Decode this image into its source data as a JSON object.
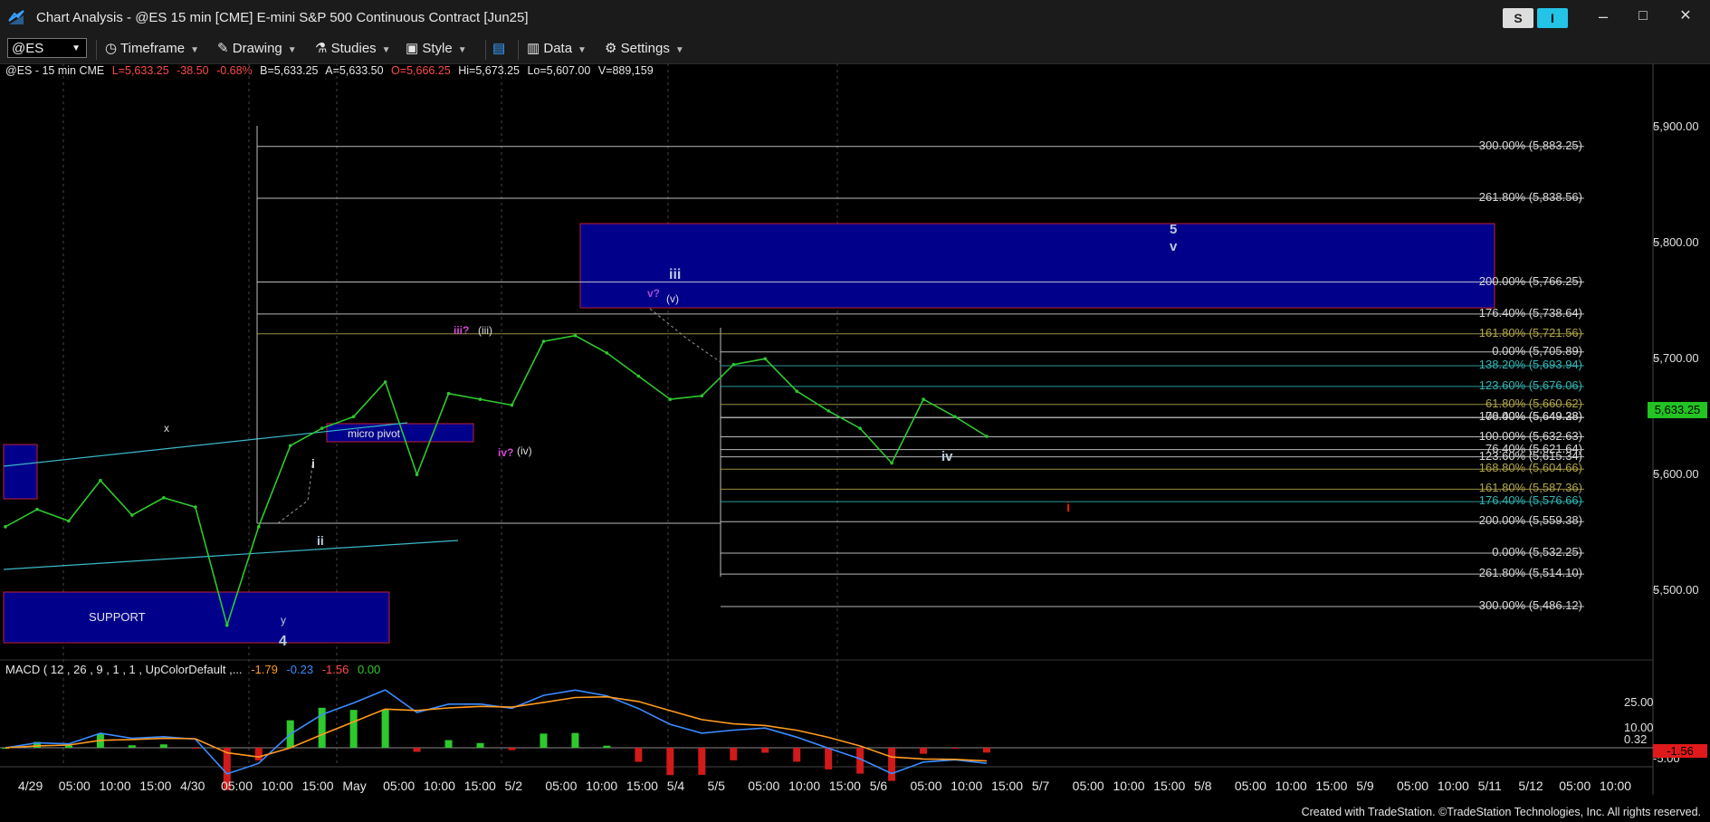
{
  "window": {
    "title": "Chart Analysis - @ES 15 min [CME] E-mini S&P 500 Continuous Contract [Jun25]",
    "s_button": "S",
    "i_button": "I",
    "minimize": "–",
    "maximize": "□",
    "close": "✕"
  },
  "toolbar": {
    "symbol": "@ES",
    "timeframe": "Timeframe",
    "drawing": "Drawing",
    "studies": "Studies",
    "style": "Style",
    "data": "Data",
    "settings": "Settings"
  },
  "quote": {
    "symbol_info": "@ES - 15 min  CME",
    "last": "L=5,633.25",
    "change": "-38.50",
    "pct": "-0.68%",
    "bid": "B=5,633.25",
    "ask": "A=5,633.50",
    "open": "O=5,666.25",
    "high": "Hi=5,673.25",
    "low": "Lo=5,607.00",
    "volume": "V=889,159"
  },
  "price_axis": {
    "labels": [
      "5,900.00",
      "5,800.00",
      "5,700.00",
      "5,600.00",
      "5,500.00"
    ],
    "last_price": "5,633.25"
  },
  "macd": {
    "title": "MACD ( 12 , 26 , 9 , 1 , 1 , UpColorDefault ,...",
    "v1": "-1.79",
    "v2": "-0.23",
    "v3": "-1.56",
    "v4": "0.00",
    "axis": [
      "25.00",
      "10.00",
      "-5.00"
    ],
    "zero_label": "0.32",
    "last_label": "-1.56"
  },
  "date_axis": [
    "4/29",
    "05:00",
    "10:00",
    "15:00",
    "4/30",
    "05:00",
    "10:00",
    "15:00",
    "May",
    "05:00",
    "10:00",
    "15:00",
    "5/2",
    "05:00",
    "10:00",
    "15:00",
    "5/4",
    "5/5",
    "05:00",
    "10:00",
    "15:00",
    "5/6",
    "05:00",
    "10:00",
    "15:00",
    "5/7",
    "05:00",
    "10:00",
    "15:00",
    "5/8",
    "05:00",
    "10:00",
    "15:00",
    "5/9",
    "05:00",
    "10:00",
    "5/11",
    "5/12",
    "05:00",
    "10:00"
  ],
  "annotations": {
    "wave_4": "4",
    "wave_y": "y",
    "wave_x": "x",
    "wave_i": "i",
    "wave_ii": "ii",
    "wave_iii_q": "iii?",
    "wave_iii_paren": "(iii)",
    "wave_iv_q": "iv?",
    "wave_iv_paren": "(iv)",
    "wave_iii": "iii",
    "wave_v_q": "v?",
    "wave_v_paren": "(v)",
    "wave_iv": "iv",
    "wave_5": "5",
    "wave_v": "v",
    "wave_i_red": "i",
    "support": "SUPPORT",
    "micro_pivot": "micro pivot"
  },
  "fib_levels_upper": [
    {
      "label": "300.00% (5,883.25)",
      "price": 5883.25
    },
    {
      "label": "261.80% (5,838.56)",
      "price": 5838.56
    },
    {
      "label": "200.00% (5,766.25)",
      "price": 5766.25
    },
    {
      "label": "176.40% (5,738.64)",
      "price": 5738.64
    },
    {
      "label": "161.80% (5,721.56)",
      "price": 5721.56
    }
  ],
  "fib_levels_lower": [
    {
      "label": "0.00% (5,705.89)",
      "price": 5705.89
    },
    {
      "label": "138.20% (5,693.94)",
      "price": 5693.94
    },
    {
      "label": "123.60% (5,676.06)",
      "price": 5676.06
    },
    {
      "label": "61.80% (5,660.62)",
      "price": 5660.62
    },
    {
      "label": "100.00% (5,649.38)",
      "price": 5649.38
    },
    {
      "label": "76.40% (5,649.28)",
      "price": 5649.28
    },
    {
      "label": "100.00% (5,632.63)",
      "price": 5632.63
    },
    {
      "label": "76.40% (5,621.64)",
      "price": 5621.64
    },
    {
      "label": "123.60% (5,615.34)",
      "price": 5615.34
    },
    {
      "label": "168.80% (5,604.66)",
      "price": 5604.66
    },
    {
      "label": "161.80% (5,587.36)",
      "price": 5587.36
    },
    {
      "label": "176.40% (5,576.66)",
      "price": 5576.66
    },
    {
      "label": "200.00% (5,559.38)",
      "price": 5559.38
    },
    {
      "label": "0.00% (5,532.25)",
      "price": 5532.25
    },
    {
      "label": "261.80% (5,514.10)",
      "price": 5514.1
    },
    {
      "label": "300.00% (5,486.12)",
      "price": 5486.12
    }
  ],
  "colors": {
    "bull_candle": "#2ec92e",
    "fib_white": "#d8d8d8",
    "fib_teal": "#33b5b5",
    "fib_olive": "#b2a64a",
    "zone_blue": "#00008b",
    "zone_border": "#c0203a",
    "macd_line": "#3b8cff",
    "signal_line": "#ff9a1f"
  },
  "chart_data": {
    "type": "line",
    "title": "",
    "xlabel": "",
    "ylabel": "",
    "ylim": [
      5440,
      5955
    ],
    "x": [
      "4/29 00:00",
      "4/29 06:00",
      "4/29 12:00",
      "4/29 18:00",
      "4/30 00:00",
      "4/30 06:00",
      "4/30 09:00",
      "4/30 12:00",
      "4/30 15:00",
      "4/30 18:00",
      "May 00:00",
      "May 06:00",
      "May 12:00",
      "May 15:00",
      "May 18:00",
      "5/2 00:00",
      "5/2 06:00",
      "5/2 10:00",
      "5/2 14:00",
      "5/2 16:00",
      "5/4 18:00",
      "5/5 00:00",
      "5/5 06:00",
      "5/5 10:00",
      "5/5 12:00",
      "5/5 16:00",
      "5/6 00:00",
      "5/6 06:00",
      "5/6 08:00",
      "5/6 10:00",
      "5/6 12:00",
      "5/6 14:00"
    ],
    "series": [
      {
        "values": [
          5555,
          5570,
          5560,
          5595,
          5565,
          5580,
          5572,
          5470,
          5555,
          5625,
          5640,
          5650,
          5680,
          5600,
          5670,
          5665,
          5660,
          5715,
          5720,
          5705,
          5685,
          5665,
          5668,
          5695,
          5700,
          5672,
          5655,
          5640,
          5610,
          5665,
          5650,
          5633
        ]
      }
    ]
  }
}
